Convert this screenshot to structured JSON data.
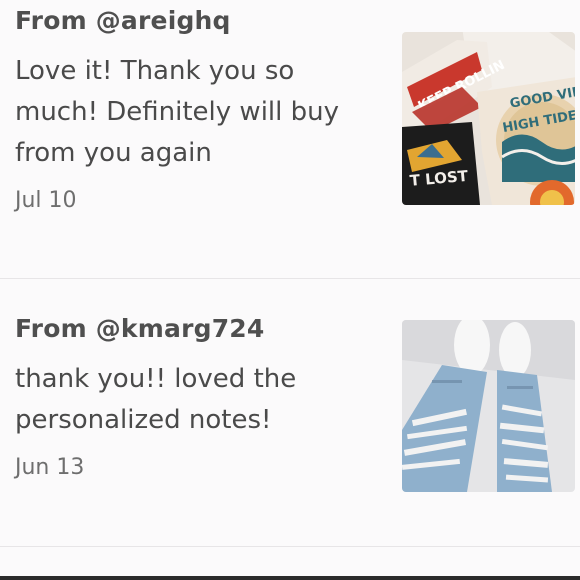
{
  "reviews": [
    {
      "from": "From @areighq",
      "comment": "Love it! Thank you so much! Definitely will buy from you again",
      "date": "Jul 10",
      "thumb_icon": "tshirts-photo",
      "thumb_text": {
        "shirt1": "KEEP ROLLIN",
        "shirt2": "GOOD VIBES",
        "shirt2b": "HIGH TIDE",
        "shirt3": "T LOST"
      }
    },
    {
      "from": "From @kmarg724",
      "comment": "thank you!! loved the personalized notes!",
      "date": "Jun 13",
      "thumb_icon": "ripped-jeans-photo"
    }
  ],
  "colors": {
    "background": "#fbfafb",
    "divider": "#e7e5e7",
    "text": "#4a4a4a",
    "muted": "#6e6e6e"
  }
}
